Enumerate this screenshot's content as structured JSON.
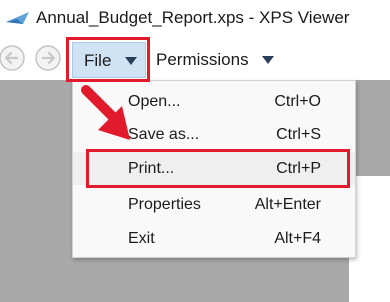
{
  "window": {
    "title": "Annual_Budget_Report.xps - XPS Viewer"
  },
  "toolbar": {
    "back_icon": "back-arrow-icon",
    "forward_icon": "forward-arrow-icon",
    "file_label": "File",
    "permissions_label": "Permissions"
  },
  "file_menu": {
    "items": [
      {
        "label": "Open...",
        "shortcut": "Ctrl+O"
      },
      {
        "label": "Save as...",
        "shortcut": "Ctrl+S"
      },
      {
        "label": "Print...",
        "shortcut": "Ctrl+P",
        "highlighted": true
      },
      {
        "label": "Properties",
        "shortcut": "Alt+Enter"
      },
      {
        "label": "Exit",
        "shortcut": "Alt+F4"
      }
    ]
  },
  "annotations": {
    "color": "#e21b2c"
  }
}
